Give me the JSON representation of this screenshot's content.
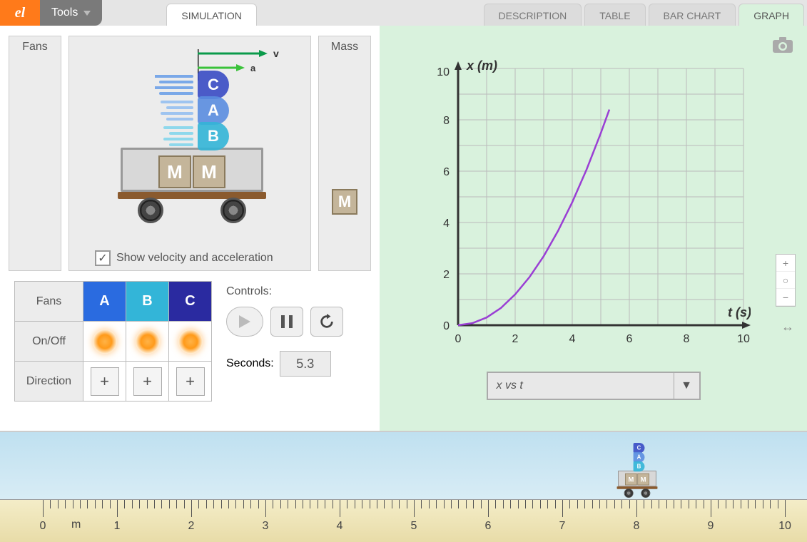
{
  "toolbar": {
    "tools_label": "Tools"
  },
  "tabs": {
    "simulation": "SIMULATION",
    "description": "DESCRIPTION",
    "table": "TABLE",
    "barchart": "BAR CHART",
    "graph": "GRAPH"
  },
  "sim": {
    "fans_label": "Fans",
    "mass_label": "Mass",
    "mass_block": "M",
    "cart_mass1": "M",
    "cart_mass2": "M",
    "fan_letters": {
      "a": "A",
      "b": "B",
      "c": "C"
    },
    "vec_v": "v",
    "vec_a": "a",
    "show_va_label": "Show velocity and acceleration",
    "show_va_checked": true
  },
  "fan_table": {
    "row_fans": "Fans",
    "row_onoff": "On/Off",
    "row_direction": "Direction",
    "hdr_a": "A",
    "hdr_b": "B",
    "hdr_c": "C",
    "dir_symbol": "+"
  },
  "controls": {
    "label": "Controls:",
    "seconds_label": "Seconds:",
    "seconds_value": "5.3"
  },
  "graph": {
    "y_label": "x (m)",
    "x_label": "t (s)",
    "y_ticks": [
      "0",
      "2",
      "4",
      "6",
      "8",
      "10"
    ],
    "x_ticks": [
      "0",
      "2",
      "4",
      "6",
      "8",
      "10"
    ],
    "dropdown_label": "x vs t"
  },
  "ruler": {
    "unit": "m",
    "labels": [
      "0",
      "1",
      "2",
      "3",
      "4",
      "5",
      "6",
      "7",
      "8",
      "9",
      "10"
    ]
  },
  "chart_data": {
    "type": "line",
    "title": "",
    "xlabel": "t (s)",
    "ylabel": "x (m)",
    "xlim": [
      0,
      10
    ],
    "ylim": [
      0,
      10
    ],
    "series": [
      {
        "name": "x vs t",
        "color": "#9a3fd4",
        "x": [
          0,
          0.5,
          1.0,
          1.5,
          2.0,
          2.5,
          3.0,
          3.5,
          4.0,
          4.5,
          5.0,
          5.3
        ],
        "y": [
          0,
          0.08,
          0.3,
          0.67,
          1.2,
          1.87,
          2.69,
          3.67,
          4.79,
          6.06,
          7.48,
          8.4
        ]
      }
    ]
  }
}
